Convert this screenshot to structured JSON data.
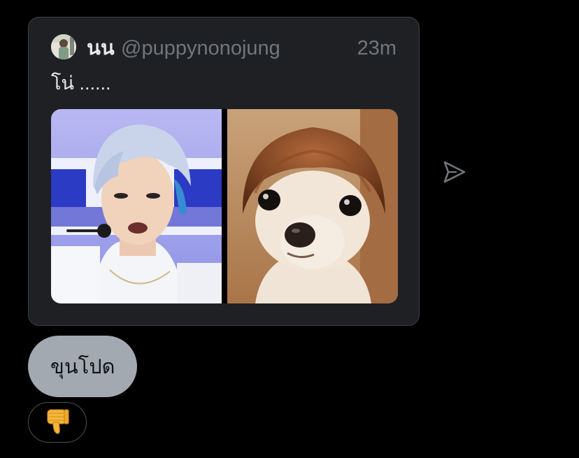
{
  "quoted_tweet": {
    "author_name": "นน",
    "author_handle": "@puppynonojung",
    "timestamp": "23m",
    "text": "โน่ ......",
    "media": [
      {
        "icon": "person-photo"
      },
      {
        "icon": "dog-with-wig-photo"
      }
    ]
  },
  "actions": {
    "share_icon": "send-icon"
  },
  "message": {
    "text": "ขุนโปด"
  },
  "reaction": {
    "emoji": "thumbs-down-icon"
  },
  "colors": {
    "background": "#000000",
    "card": "#1e2024",
    "card_border": "#3d4147",
    "bubble": "#a3a9b0",
    "muted_text": "#71767b",
    "primary_text": "#e7e9ea",
    "reaction_fill": "#f5b73d"
  }
}
